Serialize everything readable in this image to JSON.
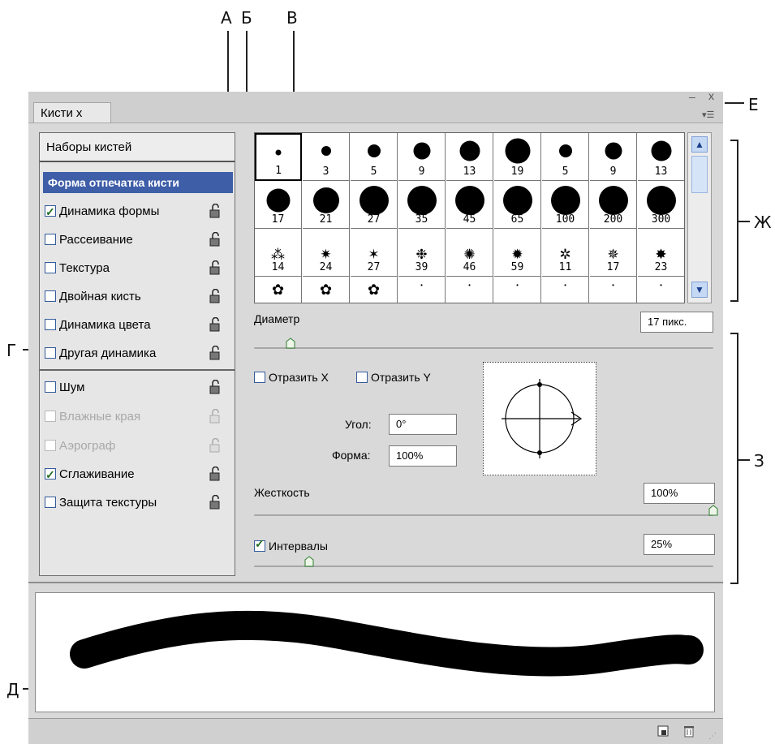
{
  "callouts": {
    "a": "А",
    "b": "Б",
    "v": "В",
    "e": "Е",
    "zh": "Ж",
    "g": "Г",
    "z": "З",
    "d": "Д"
  },
  "panel": {
    "tab_label": "Кисти",
    "tab_close": "x",
    "minimize": "–",
    "close": "x",
    "menu": "▾☰"
  },
  "left": {
    "presets": "Наборы кистей",
    "tip_shape": "Форма отпечатка кисти",
    "options": [
      {
        "label": "Динамика формы",
        "checked": true,
        "enabled": true
      },
      {
        "label": "Рассеивание",
        "checked": false,
        "enabled": true
      },
      {
        "label": "Текстура",
        "checked": false,
        "enabled": true
      },
      {
        "label": "Двойная кисть",
        "checked": false,
        "enabled": true
      },
      {
        "label": "Динамика цвета",
        "checked": false,
        "enabled": true
      },
      {
        "label": "Другая динамика",
        "checked": false,
        "enabled": true
      },
      {
        "label": "Шум",
        "checked": false,
        "enabled": true
      },
      {
        "label": "Влажные края",
        "checked": false,
        "enabled": false
      },
      {
        "label": "Аэрограф",
        "checked": false,
        "enabled": false
      },
      {
        "label": "Сглаживание",
        "checked": true,
        "enabled": true
      },
      {
        "label": "Защита текстуры",
        "checked": false,
        "enabled": true
      }
    ]
  },
  "grid": {
    "rows": [
      [
        "1",
        "3",
        "5",
        "9",
        "13",
        "19",
        "5",
        "9",
        "13"
      ],
      [
        "17",
        "21",
        "27",
        "35",
        "45",
        "65",
        "100",
        "200",
        "300"
      ],
      [
        "14",
        "24",
        "27",
        "39",
        "46",
        "59",
        "11",
        "17",
        "23"
      ],
      [
        "",
        "",
        "",
        "",
        "",
        "",
        "",
        "",
        ""
      ]
    ],
    "selected_index": 0
  },
  "controls": {
    "diameter_label": "Диаметр",
    "diameter_value": "17 пикс.",
    "flip_x": "Отразить X",
    "flip_y": "Отразить Y",
    "angle_label": "Угол:",
    "angle_value": "0°",
    "roundness_label": "Форма:",
    "roundness_value": "100%",
    "hardness_label": "Жесткость",
    "hardness_value": "100%",
    "spacing_label": "Интервалы",
    "spacing_checked": true,
    "spacing_value": "25%"
  },
  "slider_levels": {
    "diameter_fraction": 0.08,
    "hardness_fraction": 1.0,
    "spacing_fraction": 0.12
  }
}
